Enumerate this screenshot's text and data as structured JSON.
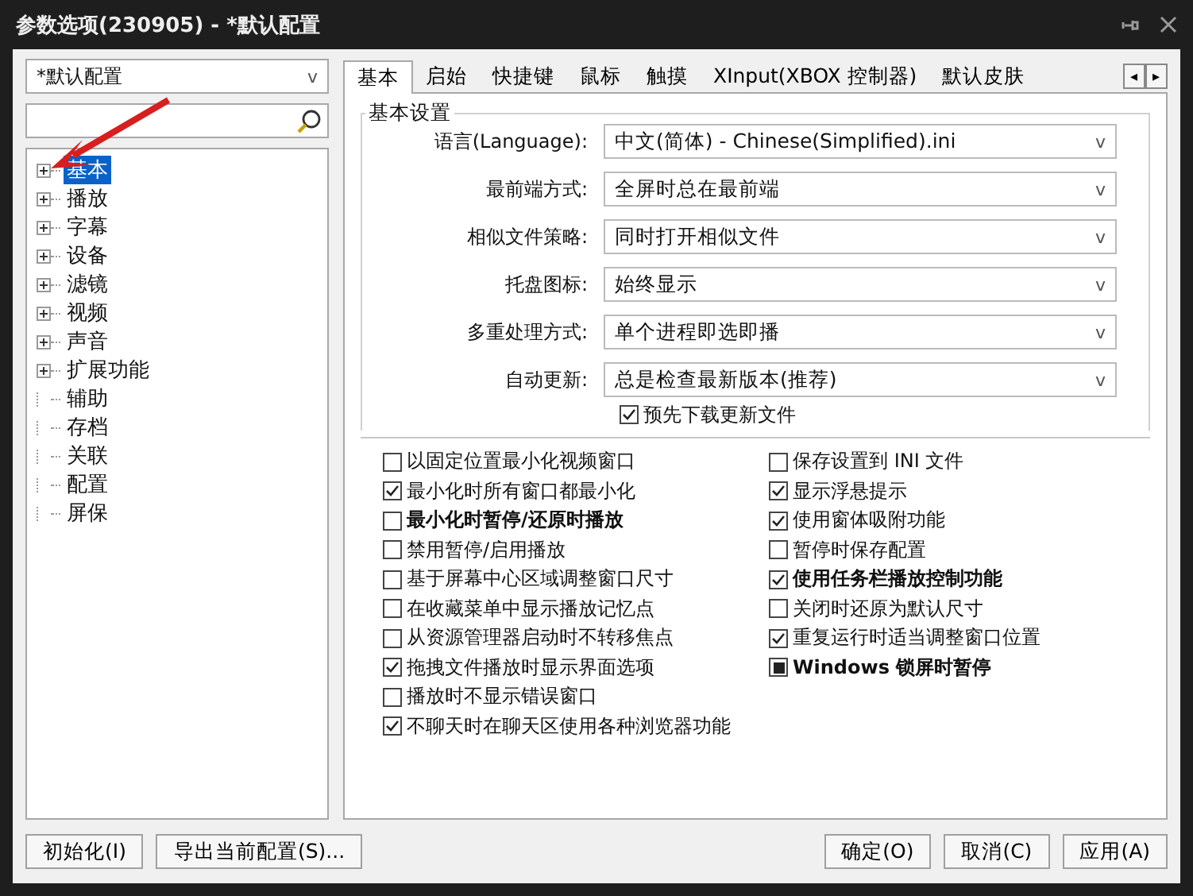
{
  "window": {
    "title": "参数选项(230905) - *默认配置"
  },
  "profile_dropdown": {
    "value": "*默认配置",
    "caret": "v"
  },
  "tree": [
    {
      "label": "基本",
      "expandable": true,
      "selected": true
    },
    {
      "label": "播放",
      "expandable": true,
      "selected": false
    },
    {
      "label": "字幕",
      "expandable": true,
      "selected": false
    },
    {
      "label": "设备",
      "expandable": true,
      "selected": false
    },
    {
      "label": "滤镜",
      "expandable": true,
      "selected": false
    },
    {
      "label": "视频",
      "expandable": true,
      "selected": false
    },
    {
      "label": "声音",
      "expandable": true,
      "selected": false
    },
    {
      "label": "扩展功能",
      "expandable": true,
      "selected": false
    },
    {
      "label": "辅助",
      "expandable": false,
      "selected": false
    },
    {
      "label": "存档",
      "expandable": false,
      "selected": false
    },
    {
      "label": "关联",
      "expandable": false,
      "selected": false
    },
    {
      "label": "配置",
      "expandable": false,
      "selected": false
    },
    {
      "label": "屏保",
      "expandable": false,
      "selected": false
    }
  ],
  "tabs": [
    {
      "label": "基本",
      "selected": true
    },
    {
      "label": "启始",
      "selected": false
    },
    {
      "label": "快捷键",
      "selected": false
    },
    {
      "label": "鼠标",
      "selected": false
    },
    {
      "label": "触摸",
      "selected": false
    },
    {
      "label": "XInput(XBOX 控制器)",
      "selected": false
    },
    {
      "label": "默认皮肤",
      "selected": false
    }
  ],
  "tab_scroll": {
    "left": "◂",
    "right": "▸"
  },
  "basic_settings": {
    "title": "基本设置",
    "fields": [
      {
        "label": "语言(Language):",
        "value": "中文(简体) - Chinese(Simplified).ini",
        "caret": "v"
      },
      {
        "label": "最前端方式:",
        "value": "全屏时总在最前端",
        "caret": "v"
      },
      {
        "label": "相似文件策略:",
        "value": "同时打开相似文件",
        "caret": "v"
      },
      {
        "label": "托盘图标:",
        "value": "始终显示",
        "caret": "v"
      },
      {
        "label": "多重处理方式:",
        "value": "单个进程即选即播",
        "caret": "v"
      },
      {
        "label": "自动更新:",
        "value": "总是检查最新版本(推荐)",
        "caret": "v"
      }
    ],
    "predownload": {
      "label": "预先下载更新文件",
      "checked": true
    }
  },
  "options_left": [
    {
      "label": "以固定位置最小化视频窗口",
      "checked": false,
      "bold": false
    },
    {
      "label": "最小化时所有窗口都最小化",
      "checked": true,
      "bold": false
    },
    {
      "label": "最小化时暂停/还原时播放",
      "checked": false,
      "bold": true
    },
    {
      "label": "禁用暂停/启用播放",
      "checked": false,
      "bold": false
    },
    {
      "label": "基于屏幕中心区域调整窗口尺寸",
      "checked": false,
      "bold": false
    },
    {
      "label": "在收藏菜单中显示播放记忆点",
      "checked": false,
      "bold": false
    },
    {
      "label": "从资源管理器启动时不转移焦点",
      "checked": false,
      "bold": false
    },
    {
      "label": "拖拽文件播放时显示界面选项",
      "checked": true,
      "bold": false
    },
    {
      "label": "播放时不显示错误窗口",
      "checked": false,
      "bold": false
    },
    {
      "label": "不聊天时在聊天区使用各种浏览器功能",
      "checked": true,
      "bold": false
    }
  ],
  "options_right": [
    {
      "label": "保存设置到 INI 文件",
      "checked": false,
      "mixed": false,
      "bold": false
    },
    {
      "label": "显示浮悬提示",
      "checked": true,
      "mixed": false,
      "bold": false
    },
    {
      "label": "使用窗体吸附功能",
      "checked": true,
      "mixed": false,
      "bold": false
    },
    {
      "label": "暂停时保存配置",
      "checked": false,
      "mixed": false,
      "bold": false
    },
    {
      "label": "使用任务栏播放控制功能",
      "checked": true,
      "mixed": false,
      "bold": true
    },
    {
      "label": "关闭时还原为默认尺寸",
      "checked": false,
      "mixed": false,
      "bold": false
    },
    {
      "label": "重复运行时适当调整窗口位置",
      "checked": true,
      "mixed": false,
      "bold": false
    },
    {
      "label": "Windows 锁屏时暂停",
      "checked": true,
      "mixed": true,
      "bold": true
    }
  ],
  "footer_left": [
    "初始化(I)",
    "导出当前配置(S)..."
  ],
  "footer_right": [
    "确定(O)",
    "取消(C)",
    "应用(A)"
  ]
}
